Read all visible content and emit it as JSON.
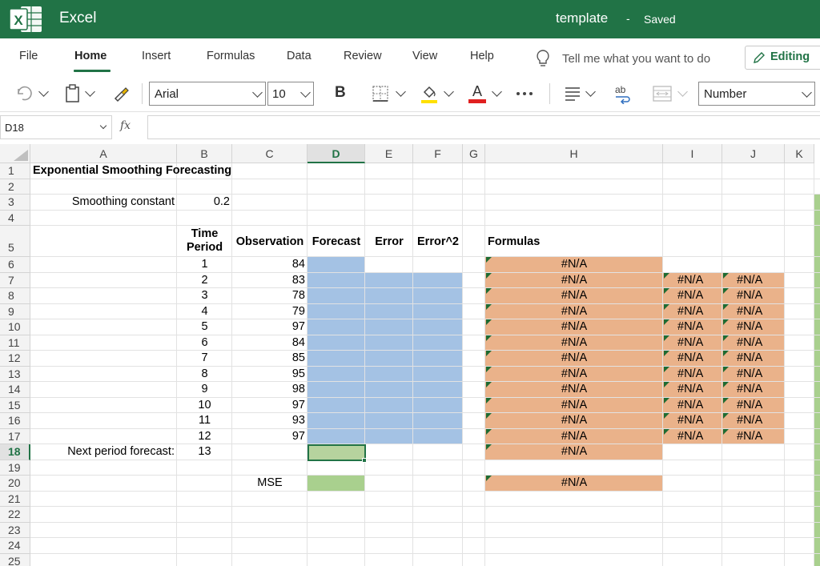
{
  "app": {
    "name": "Excel",
    "doc_title": "template",
    "separator": "-",
    "status": "Saved"
  },
  "menu": {
    "items": [
      "File",
      "Home",
      "Insert",
      "Formulas",
      "Data",
      "Review",
      "View",
      "Help"
    ],
    "active": "Home",
    "tell_me": "Tell me what you want to do",
    "editing": "Editing"
  },
  "toolbar": {
    "font": "Arial",
    "size": "10",
    "bold": "B",
    "ab_label": "ab",
    "number_format": "Number"
  },
  "formula_bar": {
    "name_box": "D18",
    "fx": "fx",
    "value": ""
  },
  "columns": [
    "A",
    "B",
    "C",
    "D",
    "E",
    "F",
    "G",
    "H",
    "I",
    "J",
    "K"
  ],
  "rows": [
    "1",
    "2",
    "3",
    "4",
    "5",
    "6",
    "7",
    "8",
    "9",
    "10",
    "11",
    "12",
    "13",
    "14",
    "15",
    "16",
    "17",
    "18",
    "19",
    "20",
    "21",
    "22",
    "23",
    "24",
    "25"
  ],
  "selected_cell": {
    "column": "D",
    "row": "18"
  },
  "sheet": {
    "title": "Exponential Smoothing Forecasting",
    "smoothing_label": "Smoothing constant",
    "smoothing_value": "0.2",
    "headers": {
      "time_period": "Time Period",
      "observation": "Observation",
      "forecast": "Forecast",
      "error": "Error",
      "error_sq": "Error^2",
      "formulas": "Formulas"
    },
    "periods": [
      "1",
      "2",
      "3",
      "4",
      "5",
      "6",
      "7",
      "8",
      "9",
      "10",
      "11",
      "12"
    ],
    "observations": [
      "84",
      "83",
      "78",
      "79",
      "97",
      "84",
      "85",
      "95",
      "98",
      "97",
      "93",
      "97"
    ],
    "next_label": "Next period forecast:",
    "next_period": "13",
    "mse_label": "MSE",
    "na": "#N/A"
  },
  "colors": {
    "brand": "#217346",
    "input_fill": "#a4c2e4",
    "formula_fill": "#eab28a",
    "output_fill": "#b6d39e"
  },
  "icons": [
    "excel-logo-icon",
    "lightbulb-icon",
    "pencil-icon",
    "undo-icon",
    "paste-icon",
    "format-painter-icon",
    "borders-icon",
    "fill-color-icon",
    "font-color-icon",
    "more-icon",
    "align-icon",
    "wrap-text-icon",
    "merge-icon"
  ]
}
